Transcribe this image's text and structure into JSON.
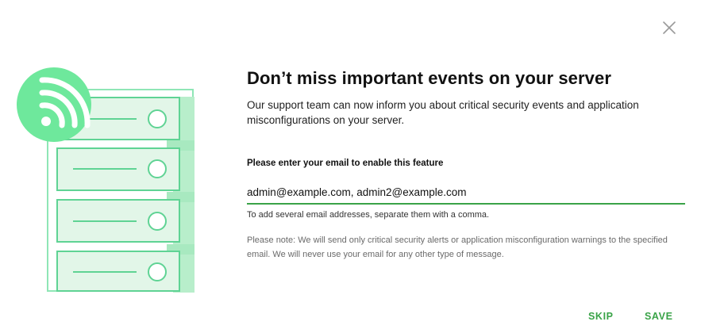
{
  "dialog": {
    "close_icon": "close-icon",
    "illustration_icons": [
      "server-rack-icon",
      "rss-feed-icon"
    ],
    "title": "Don’t miss important events on your server",
    "description": "Our support team can now inform you about critical security events and application misconfigurations on your server.",
    "email_field": {
      "label": "Please enter your email to enable this feature",
      "value": "admin@example.com, admin2@example.com",
      "helper": "To add several email addresses, separate them with a comma."
    },
    "note": "Please note: We will send only critical security alerts or application misconfiguration warnings to the specified email. We will never use your email for any other type of message.",
    "actions": {
      "skip_label": "SKIP",
      "save_label": "SAVE"
    },
    "colors": {
      "accent": "#3aa348",
      "illustration_green": "#6ee89c",
      "illustration_light": "#e2f6e8",
      "illustration_stroke": "#5fd394"
    }
  }
}
